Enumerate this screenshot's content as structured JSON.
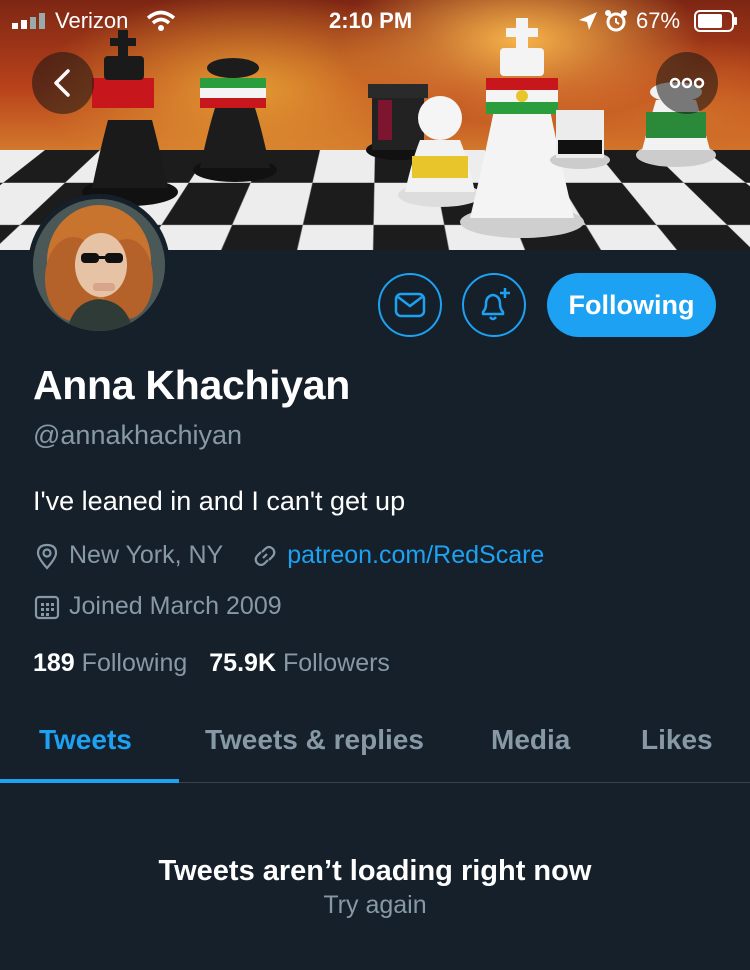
{
  "status_bar": {
    "carrier": "Verizon",
    "time": "2:10 PM",
    "battery": "67%"
  },
  "profile": {
    "name": "Anna Khachiyan",
    "handle": "@annakhachiyan",
    "bio": "I've leaned in and I can't get up",
    "location": "New York, NY",
    "website": "patreon.com/RedScare",
    "joined": "Joined March 2009",
    "following_count": "189",
    "following_label": "Following",
    "followers_count": "75.9K",
    "followers_label": "Followers"
  },
  "actions": {
    "follow_button": "Following"
  },
  "tabs": [
    {
      "label": "Tweets",
      "active": true
    },
    {
      "label": "Tweets & replies",
      "active": false
    },
    {
      "label": "Media",
      "active": false
    },
    {
      "label": "Likes",
      "active": false
    }
  ],
  "timeline": {
    "message": "Tweets aren’t loading right now",
    "retry": "Try again"
  },
  "colors": {
    "background": "#15202b",
    "accent": "#1da1f2",
    "secondary_text": "#8899a6"
  },
  "icons": [
    "back-arrow-icon",
    "more-icon",
    "mail-icon",
    "bell-plus-icon",
    "location-pin-icon",
    "link-icon",
    "calendar-icon"
  ]
}
